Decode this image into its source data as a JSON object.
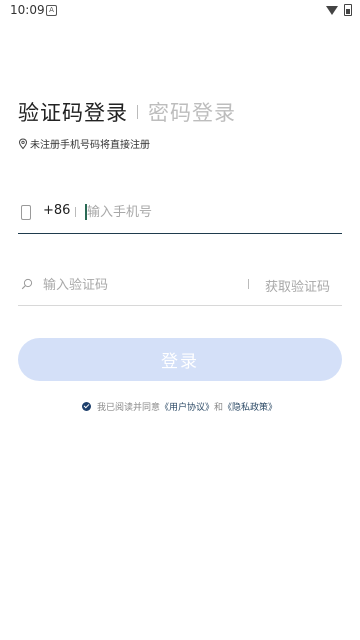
{
  "status_bar": {
    "time": "10:09",
    "notification_icon_text": "A",
    "icons": [
      "wifi-icon",
      "battery-icon"
    ]
  },
  "tabs": {
    "active": "验证码登录",
    "inactive": "密码登录"
  },
  "hint": "未注册手机号码将直接注册",
  "phone_field": {
    "country_code": "+86",
    "placeholder": "输入手机号",
    "value": ""
  },
  "code_field": {
    "placeholder": "输入验证码",
    "value": "",
    "get_code_label": "获取验证码"
  },
  "login_button": "登录",
  "agreement": {
    "prefix": "我已阅读并同意",
    "user_agreement": "《用户协议》",
    "conjunction": "和",
    "privacy_policy": "《隐私政策》",
    "checked": true
  },
  "colors": {
    "button_bg": "#d4e0f8",
    "focus_line": "#1f3b4d",
    "link": "#2c4a66",
    "checkbox": "#1d3f6b"
  }
}
